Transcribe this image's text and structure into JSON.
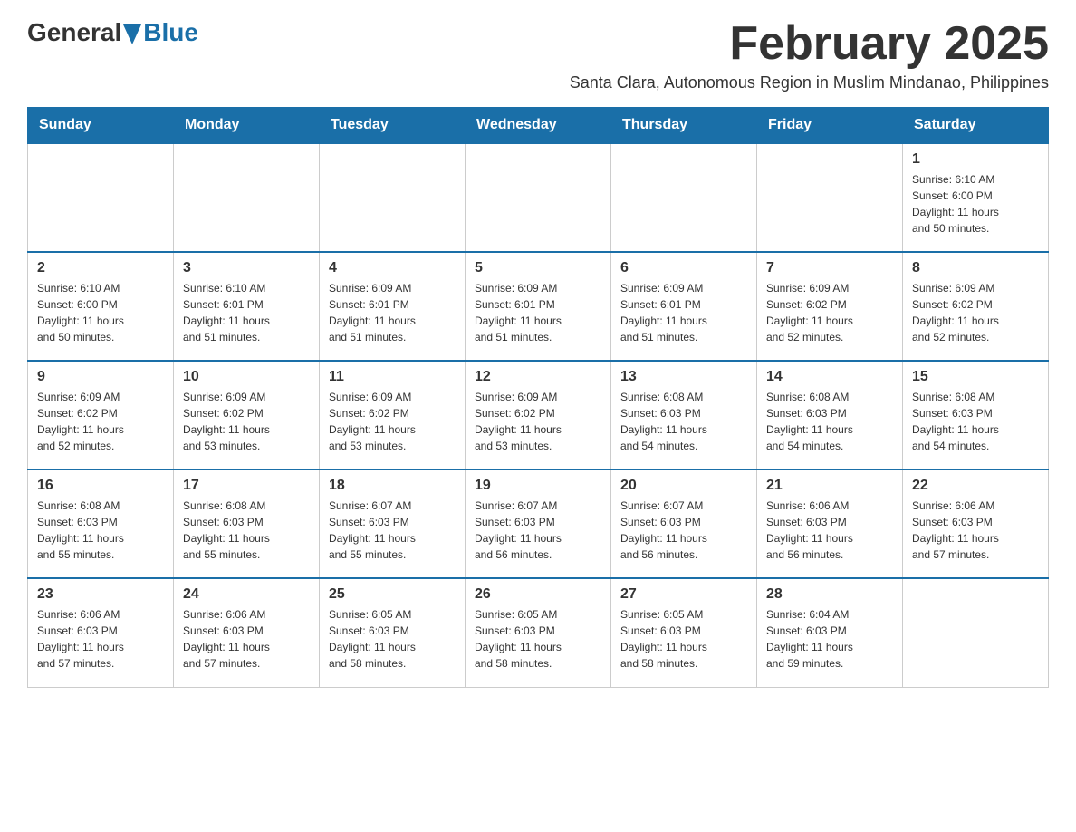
{
  "logo": {
    "general": "General",
    "blue": "Blue"
  },
  "header": {
    "title": "February 2025",
    "subtitle": "Santa Clara, Autonomous Region in Muslim Mindanao, Philippines"
  },
  "weekdays": [
    "Sunday",
    "Monday",
    "Tuesday",
    "Wednesday",
    "Thursday",
    "Friday",
    "Saturday"
  ],
  "weeks": [
    [
      {
        "day": "",
        "info": ""
      },
      {
        "day": "",
        "info": ""
      },
      {
        "day": "",
        "info": ""
      },
      {
        "day": "",
        "info": ""
      },
      {
        "day": "",
        "info": ""
      },
      {
        "day": "",
        "info": ""
      },
      {
        "day": "1",
        "info": "Sunrise: 6:10 AM\nSunset: 6:00 PM\nDaylight: 11 hours\nand 50 minutes."
      }
    ],
    [
      {
        "day": "2",
        "info": "Sunrise: 6:10 AM\nSunset: 6:00 PM\nDaylight: 11 hours\nand 50 minutes."
      },
      {
        "day": "3",
        "info": "Sunrise: 6:10 AM\nSunset: 6:01 PM\nDaylight: 11 hours\nand 51 minutes."
      },
      {
        "day": "4",
        "info": "Sunrise: 6:09 AM\nSunset: 6:01 PM\nDaylight: 11 hours\nand 51 minutes."
      },
      {
        "day": "5",
        "info": "Sunrise: 6:09 AM\nSunset: 6:01 PM\nDaylight: 11 hours\nand 51 minutes."
      },
      {
        "day": "6",
        "info": "Sunrise: 6:09 AM\nSunset: 6:01 PM\nDaylight: 11 hours\nand 51 minutes."
      },
      {
        "day": "7",
        "info": "Sunrise: 6:09 AM\nSunset: 6:02 PM\nDaylight: 11 hours\nand 52 minutes."
      },
      {
        "day": "8",
        "info": "Sunrise: 6:09 AM\nSunset: 6:02 PM\nDaylight: 11 hours\nand 52 minutes."
      }
    ],
    [
      {
        "day": "9",
        "info": "Sunrise: 6:09 AM\nSunset: 6:02 PM\nDaylight: 11 hours\nand 52 minutes."
      },
      {
        "day": "10",
        "info": "Sunrise: 6:09 AM\nSunset: 6:02 PM\nDaylight: 11 hours\nand 53 minutes."
      },
      {
        "day": "11",
        "info": "Sunrise: 6:09 AM\nSunset: 6:02 PM\nDaylight: 11 hours\nand 53 minutes."
      },
      {
        "day": "12",
        "info": "Sunrise: 6:09 AM\nSunset: 6:02 PM\nDaylight: 11 hours\nand 53 minutes."
      },
      {
        "day": "13",
        "info": "Sunrise: 6:08 AM\nSunset: 6:03 PM\nDaylight: 11 hours\nand 54 minutes."
      },
      {
        "day": "14",
        "info": "Sunrise: 6:08 AM\nSunset: 6:03 PM\nDaylight: 11 hours\nand 54 minutes."
      },
      {
        "day": "15",
        "info": "Sunrise: 6:08 AM\nSunset: 6:03 PM\nDaylight: 11 hours\nand 54 minutes."
      }
    ],
    [
      {
        "day": "16",
        "info": "Sunrise: 6:08 AM\nSunset: 6:03 PM\nDaylight: 11 hours\nand 55 minutes."
      },
      {
        "day": "17",
        "info": "Sunrise: 6:08 AM\nSunset: 6:03 PM\nDaylight: 11 hours\nand 55 minutes."
      },
      {
        "day": "18",
        "info": "Sunrise: 6:07 AM\nSunset: 6:03 PM\nDaylight: 11 hours\nand 55 minutes."
      },
      {
        "day": "19",
        "info": "Sunrise: 6:07 AM\nSunset: 6:03 PM\nDaylight: 11 hours\nand 56 minutes."
      },
      {
        "day": "20",
        "info": "Sunrise: 6:07 AM\nSunset: 6:03 PM\nDaylight: 11 hours\nand 56 minutes."
      },
      {
        "day": "21",
        "info": "Sunrise: 6:06 AM\nSunset: 6:03 PM\nDaylight: 11 hours\nand 56 minutes."
      },
      {
        "day": "22",
        "info": "Sunrise: 6:06 AM\nSunset: 6:03 PM\nDaylight: 11 hours\nand 57 minutes."
      }
    ],
    [
      {
        "day": "23",
        "info": "Sunrise: 6:06 AM\nSunset: 6:03 PM\nDaylight: 11 hours\nand 57 minutes."
      },
      {
        "day": "24",
        "info": "Sunrise: 6:06 AM\nSunset: 6:03 PM\nDaylight: 11 hours\nand 57 minutes."
      },
      {
        "day": "25",
        "info": "Sunrise: 6:05 AM\nSunset: 6:03 PM\nDaylight: 11 hours\nand 58 minutes."
      },
      {
        "day": "26",
        "info": "Sunrise: 6:05 AM\nSunset: 6:03 PM\nDaylight: 11 hours\nand 58 minutes."
      },
      {
        "day": "27",
        "info": "Sunrise: 6:05 AM\nSunset: 6:03 PM\nDaylight: 11 hours\nand 58 minutes."
      },
      {
        "day": "28",
        "info": "Sunrise: 6:04 AM\nSunset: 6:03 PM\nDaylight: 11 hours\nand 59 minutes."
      },
      {
        "day": "",
        "info": ""
      }
    ]
  ]
}
